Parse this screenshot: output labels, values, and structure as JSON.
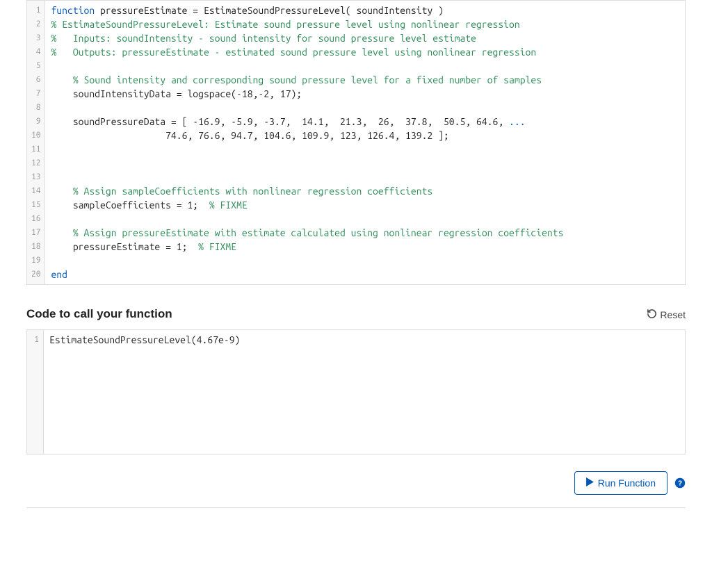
{
  "editor": {
    "lines": [
      [
        {
          "cls": "tok-kw",
          "text": "function"
        },
        {
          "cls": "tok-plain",
          "text": " pressureEstimate = EstimateSoundPressureLevel( soundIntensity )"
        }
      ],
      [
        {
          "cls": "tok-comment",
          "text": "% EstimateSoundPressureLevel: Estimate sound pressure level using nonlinear regression"
        }
      ],
      [
        {
          "cls": "tok-comment",
          "text": "%   Inputs: soundIntensity - sound intensity for sound pressure level estimate"
        }
      ],
      [
        {
          "cls": "tok-comment",
          "text": "%   Outputs: pressureEstimate - estimated sound pressure level using nonlinear regression"
        }
      ],
      [
        {
          "cls": "tok-plain",
          "text": ""
        }
      ],
      [
        {
          "cls": "tok-plain",
          "text": "    "
        },
        {
          "cls": "tok-comment",
          "text": "% Sound intensity and corresponding sound pressure level for a fixed number of samples"
        }
      ],
      [
        {
          "cls": "tok-plain",
          "text": "    soundIntensityData = logspace(-18,-2, 17);"
        }
      ],
      [
        {
          "cls": "tok-plain",
          "text": ""
        }
      ],
      [
        {
          "cls": "tok-plain",
          "text": "    soundPressureData = [ -16.9, -5.9, -3.7,  14.1,  21.3,  26,  37.8,  50.5, 64.6, "
        },
        {
          "cls": "tok-kw",
          "text": "..."
        }
      ],
      [
        {
          "cls": "tok-plain",
          "text": "                     74.6, 76.6, 94.7, 104.6, 109.9, 123, 126.4, 139.2 ];"
        }
      ],
      [
        {
          "cls": "tok-plain",
          "text": ""
        }
      ],
      [
        {
          "cls": "tok-plain",
          "text": ""
        }
      ],
      [
        {
          "cls": "tok-plain",
          "text": ""
        }
      ],
      [
        {
          "cls": "tok-plain",
          "text": "    "
        },
        {
          "cls": "tok-comment",
          "text": "% Assign sampleCoefficients with nonlinear regression coefficients"
        }
      ],
      [
        {
          "cls": "tok-plain",
          "text": "    sampleCoefficients = 1;  "
        },
        {
          "cls": "tok-comment",
          "text": "% FIXME"
        }
      ],
      [
        {
          "cls": "tok-plain",
          "text": ""
        }
      ],
      [
        {
          "cls": "tok-plain",
          "text": "    "
        },
        {
          "cls": "tok-comment",
          "text": "% Assign pressureEstimate with estimate calculated using nonlinear regression coefficients"
        }
      ],
      [
        {
          "cls": "tok-plain",
          "text": "    pressureEstimate = 1;  "
        },
        {
          "cls": "tok-comment",
          "text": "% FIXME"
        }
      ],
      [
        {
          "cls": "tok-plain",
          "text": ""
        }
      ],
      [
        {
          "cls": "tok-kw",
          "text": "end"
        }
      ]
    ]
  },
  "call_section": {
    "title": "Code to call your function",
    "reset_label": "Reset"
  },
  "call_editor": {
    "lines": [
      [
        {
          "cls": "tok-plain",
          "text": "EstimateSoundPressureLevel(4.67e-9)"
        }
      ]
    ]
  },
  "footer": {
    "run_label": "Run Function"
  }
}
